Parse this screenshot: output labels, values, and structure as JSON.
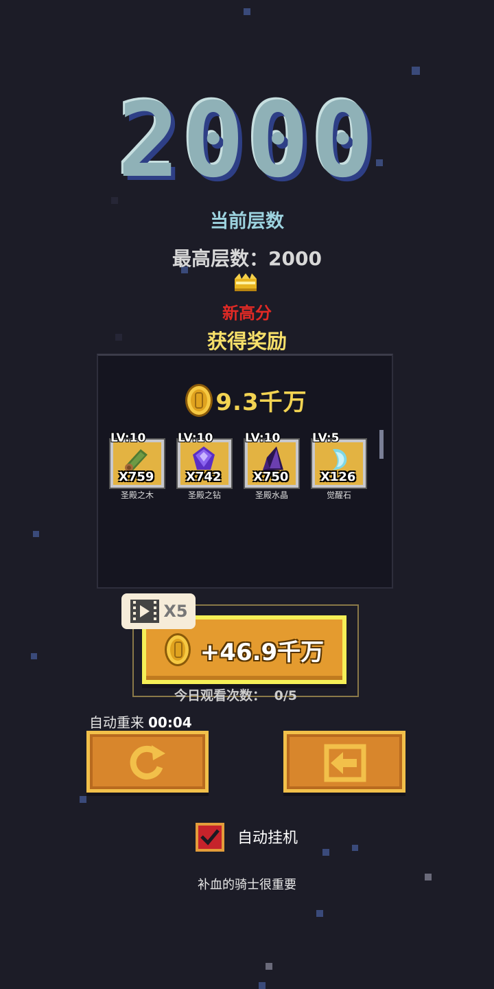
{
  "score": "2000",
  "floor_label": "当前层数",
  "best_floor": {
    "label": "最高层数：",
    "value": "2000"
  },
  "new_high_label": "新高分",
  "reward_title": "获得奖励",
  "gold_reward": "9.3千万",
  "items": [
    {
      "level": "LV:10",
      "count": "X759",
      "name": "圣殿之木",
      "icon": "wood-log-icon",
      "color": "#5a8a3a"
    },
    {
      "level": "LV:10",
      "count": "X742",
      "name": "圣殿之钻",
      "icon": "purple-diamond-icon",
      "color": "#6a3fd6"
    },
    {
      "level": "LV:10",
      "count": "X750",
      "name": "圣殿水晶",
      "icon": "dark-crystal-icon",
      "color": "#3c1f6a"
    },
    {
      "level": "LV:5",
      "count": "X126",
      "name": "觉醒石",
      "icon": "awaken-stone-icon",
      "color": "#7fd8e6"
    }
  ],
  "video_reward": {
    "multiplier": "X5",
    "amount": "+46.9千万"
  },
  "watch_count": {
    "label": "今日观看次数：",
    "value": "0/5"
  },
  "auto_restart": {
    "label": "自动重来",
    "timer": "00:04"
  },
  "auto_idle": {
    "label": "自动挂机",
    "checked": true
  },
  "tip": "补血的骑士很重要",
  "colors": {
    "background": "#1c1c27",
    "gold": "#f2d352",
    "new_high": "#e12a25",
    "button": "#e49b2f"
  }
}
